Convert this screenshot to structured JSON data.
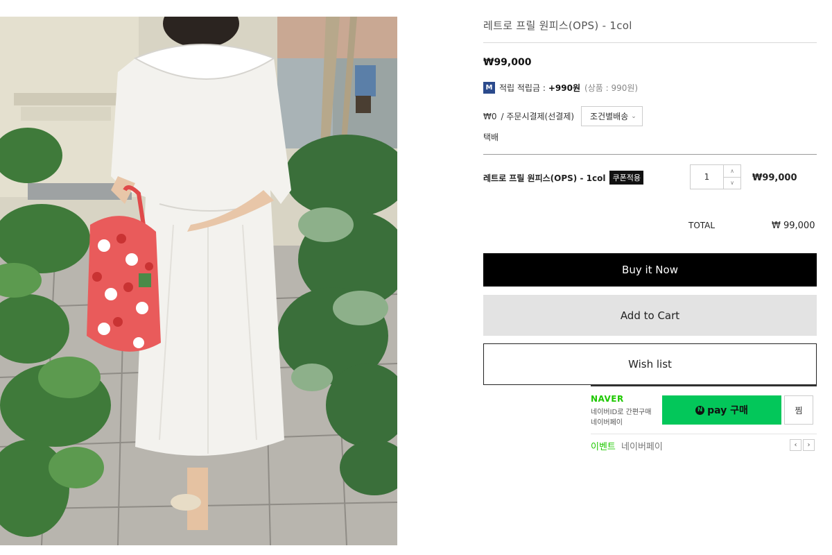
{
  "product": {
    "title": "레트로 프릴 원피스(OPS) - 1col",
    "price": "₩99,000"
  },
  "mileage": {
    "badge": "M",
    "label": "적립 적립금 :",
    "amount": "+990원",
    "sub": "(상품 : 990원)"
  },
  "shipping": {
    "fee": "₩0",
    "method": "/ 주문시결제(선결제)",
    "button_label": "조건별배송",
    "type": "택배"
  },
  "option_row": {
    "name": "레트로 프릴 원피스(OPS) - 1col",
    "coupon_label": "쿠폰적용",
    "quantity": "1",
    "price": "₩99,000"
  },
  "total": {
    "label": "TOTAL",
    "value": "₩ 99,000"
  },
  "actions": {
    "buy_now": "Buy it Now",
    "add_to_cart": "Add to Cart",
    "wish_list": "Wish list"
  },
  "naver_pay": {
    "brand": "NAVER",
    "desc_line1": "네이버ID로 간편구매",
    "desc_line2": "네이버페이",
    "pay_icon": "N",
    "pay_label": "pay 구매",
    "zzim_label": "찜",
    "event_label": "이벤트",
    "event_sub": "네이버페이",
    "prev_icon": "‹",
    "next_icon": "›",
    "accent_color": "#03c75a"
  },
  "icons": {
    "qty_up": "chevron-up-icon",
    "qty_down": "chevron-down-icon",
    "dropdown": "chevron-down-icon"
  }
}
